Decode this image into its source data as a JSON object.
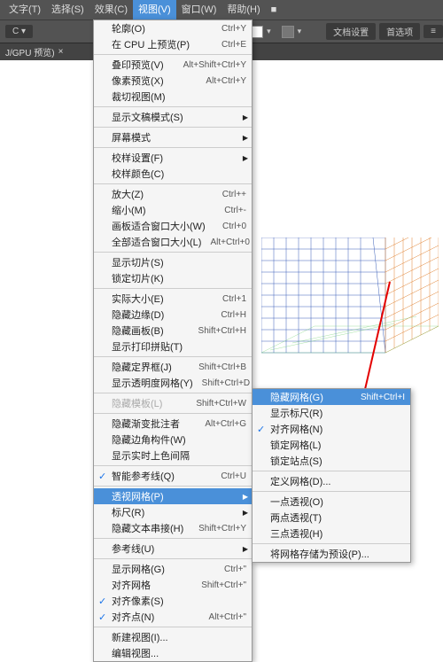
{
  "menubar": {
    "items": [
      {
        "label": "文字(T)"
      },
      {
        "label": "选择(S)"
      },
      {
        "label": "效果(C)"
      },
      {
        "label": "视图(V)",
        "open": true
      },
      {
        "label": "窗口(W)"
      },
      {
        "label": "帮助(H)"
      },
      {
        "label": "■"
      }
    ]
  },
  "toolbar": {
    "cdrop": "C",
    "label1": "文档设置",
    "label2": "首选项",
    "icon": "≡"
  },
  "tab": {
    "label": "J/GPU 预览)",
    "close": "×"
  },
  "viewMenu": [
    {
      "label": "轮廓(O)",
      "shortcut": "Ctrl+Y"
    },
    {
      "label": "在 CPU 上预览(P)",
      "shortcut": "Ctrl+E"
    },
    {
      "sep": true
    },
    {
      "label": "叠印预览(V)",
      "shortcut": "Alt+Shift+Ctrl+Y"
    },
    {
      "label": "像素预览(X)",
      "shortcut": "Alt+Ctrl+Y"
    },
    {
      "label": "裁切视图(M)"
    },
    {
      "sep": true
    },
    {
      "label": "显示文稿模式(S)",
      "sub": true
    },
    {
      "sep": true
    },
    {
      "label": "屏幕模式",
      "sub": true
    },
    {
      "sep": true
    },
    {
      "label": "校样设置(F)",
      "sub": true
    },
    {
      "label": "校样颜色(C)"
    },
    {
      "sep": true
    },
    {
      "label": "放大(Z)",
      "shortcut": "Ctrl++"
    },
    {
      "label": "缩小(M)",
      "shortcut": "Ctrl+-"
    },
    {
      "label": "画板适合窗口大小(W)",
      "shortcut": "Ctrl+0"
    },
    {
      "label": "全部适合窗口大小(L)",
      "shortcut": "Alt+Ctrl+0"
    },
    {
      "sep": true
    },
    {
      "label": "显示切片(S)"
    },
    {
      "label": "锁定切片(K)"
    },
    {
      "sep": true
    },
    {
      "label": "实际大小(E)",
      "shortcut": "Ctrl+1"
    },
    {
      "label": "隐藏边缘(D)",
      "shortcut": "Ctrl+H"
    },
    {
      "label": "隐藏画板(B)",
      "shortcut": "Shift+Ctrl+H"
    },
    {
      "label": "显示打印拼贴(T)"
    },
    {
      "sep": true
    },
    {
      "label": "隐藏定界框(J)",
      "shortcut": "Shift+Ctrl+B"
    },
    {
      "label": "显示透明度网格(Y)",
      "shortcut": "Shift+Ctrl+D"
    },
    {
      "sep": true
    },
    {
      "label": "隐藏模板(L)",
      "shortcut": "Shift+Ctrl+W",
      "disabled": true
    },
    {
      "sep": true
    },
    {
      "label": "隐藏渐变批注者",
      "shortcut": "Alt+Ctrl+G"
    },
    {
      "label": "隐藏边角构件(W)"
    },
    {
      "label": "显示实时上色间隔"
    },
    {
      "sep": true
    },
    {
      "label": "智能参考线(Q)",
      "shortcut": "Ctrl+U",
      "checked": true
    },
    {
      "sep": true
    },
    {
      "label": "透视网格(P)",
      "sub": true,
      "highlight": true
    },
    {
      "label": "标尺(R)",
      "sub": true
    },
    {
      "label": "隐藏文本串接(H)",
      "shortcut": "Shift+Ctrl+Y"
    },
    {
      "sep": true
    },
    {
      "label": "参考线(U)",
      "sub": true
    },
    {
      "sep": true
    },
    {
      "label": "显示网格(G)",
      "shortcut": "Ctrl+\""
    },
    {
      "label": "对齐网格",
      "shortcut": "Shift+Ctrl+\""
    },
    {
      "label": "对齐像素(S)",
      "checked": true
    },
    {
      "label": "对齐点(N)",
      "shortcut": "Alt+Ctrl+\"",
      "checked": true
    },
    {
      "sep": true
    },
    {
      "label": "新建视图(I)..."
    },
    {
      "label": "编辑视图..."
    }
  ],
  "subMenu": [
    {
      "label": "隐藏网格(G)",
      "shortcut": "Shift+Ctrl+I",
      "highlight": true
    },
    {
      "label": "显示标尺(R)"
    },
    {
      "label": "对齐网格(N)",
      "checked": true
    },
    {
      "label": "锁定网格(L)"
    },
    {
      "label": "锁定站点(S)"
    },
    {
      "sep": true
    },
    {
      "label": "定义网格(D)..."
    },
    {
      "sep": true
    },
    {
      "label": "一点透视(O)"
    },
    {
      "label": "两点透视(T)"
    },
    {
      "label": "三点透视(H)"
    },
    {
      "sep": true
    },
    {
      "label": "将网格存储为预设(P)..."
    }
  ]
}
